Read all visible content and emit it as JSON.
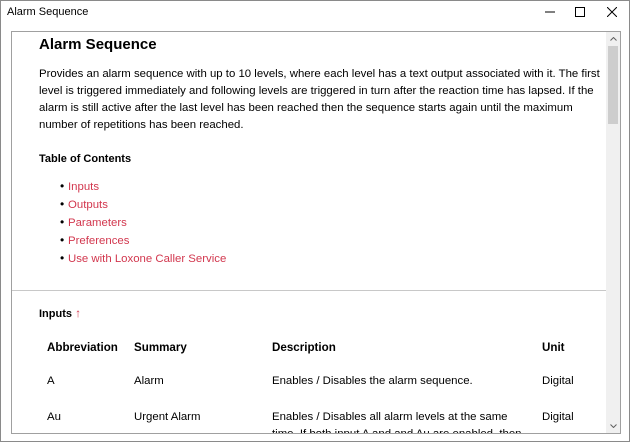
{
  "window": {
    "title": "Alarm Sequence",
    "minimize_icon": "minimize-icon",
    "maximize_icon": "maximize-icon",
    "close_icon": "close-icon"
  },
  "doc": {
    "title": "Alarm Sequence",
    "intro": "Provides an alarm sequence with up to 10 levels, where each level has a text output associated with it. The first level is triggered immediately and following levels are triggered in turn after the reaction time has lapsed. If the alarm is still active after the last level has been reached then the sequence starts again until the maximum number of repetitions has been reached.",
    "toc_title": "Table of Contents",
    "toc": [
      {
        "label": "Inputs"
      },
      {
        "label": "Outputs"
      },
      {
        "label": "Parameters"
      },
      {
        "label": "Preferences"
      },
      {
        "label": "Use with Loxone Caller Service"
      }
    ]
  },
  "inputs_section": {
    "title": "Inputs",
    "up_arrow": "↑",
    "columns": [
      "Abbreviation",
      "Summary",
      "Description",
      "Unit"
    ],
    "rows": [
      {
        "abbr": "A",
        "summary": "Alarm",
        "description": "Enables / Disables the alarm sequence.",
        "unit": "Digital"
      },
      {
        "abbr": "Au",
        "summary": "Urgent Alarm",
        "description": "Enables / Disables all alarm levels at the same time. If both input A and and Au are enabled, then Au",
        "unit": "Digital"
      }
    ]
  },
  "colors": {
    "link": "#d2374e",
    "scroll_thumb": "#cdcdcd",
    "divider": "#c8c8c8"
  }
}
